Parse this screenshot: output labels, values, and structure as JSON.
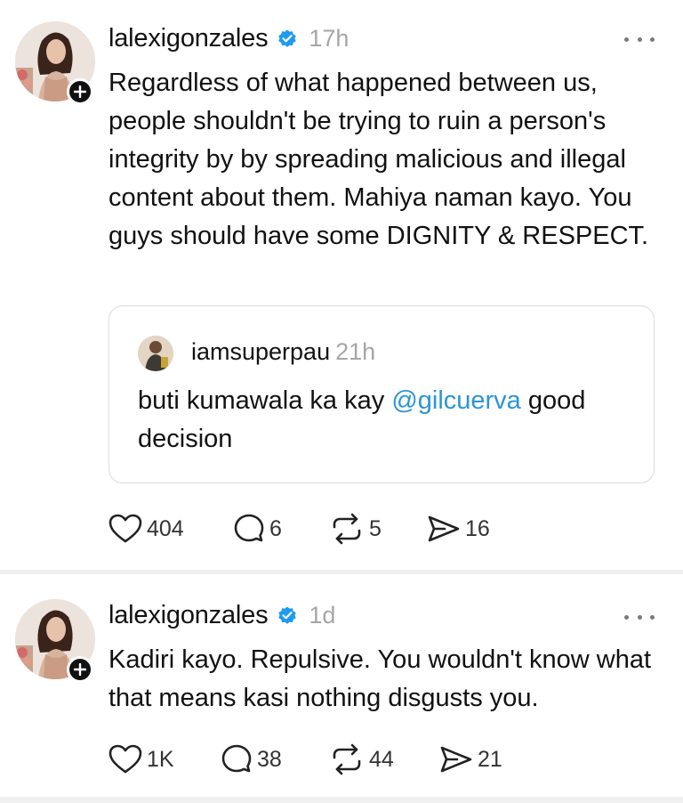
{
  "posts": [
    {
      "username": "lalexigonzales",
      "time": "17h",
      "text": "Regardless of what happened between us, people shouldn't be trying to ruin a person's integrity by by spreading malicious and illegal content about them. Mahiya naman kayo. You guys should have some DIGNITY & RESPECT.",
      "quote": {
        "username": "iamsuperpau",
        "time": "21h",
        "text_before": "buti kumawala ka kay ",
        "mention": "@gilcuerva",
        "text_after": " good decision"
      },
      "likes": "404",
      "replies": "6",
      "reposts": "5",
      "shares": "16"
    },
    {
      "username": "lalexigonzales",
      "time": "1d",
      "text": "Kadiri kayo. Repulsive. You wouldn't know what that means kasi nothing disgusts you.",
      "likes": "1K",
      "replies": "38",
      "reposts": "44",
      "shares": "21"
    }
  ],
  "icons": {
    "verified": "verified-badge-icon",
    "follow": "plus-icon",
    "more": "more-dots-icon",
    "like": "heart-icon",
    "reply": "comment-bubble-icon",
    "repost": "repost-arrows-icon",
    "share": "send-icon"
  },
  "colors": {
    "verified": "#1d9bf0",
    "mention": "#2b95d6",
    "timestamp": "#a6a6a6"
  }
}
